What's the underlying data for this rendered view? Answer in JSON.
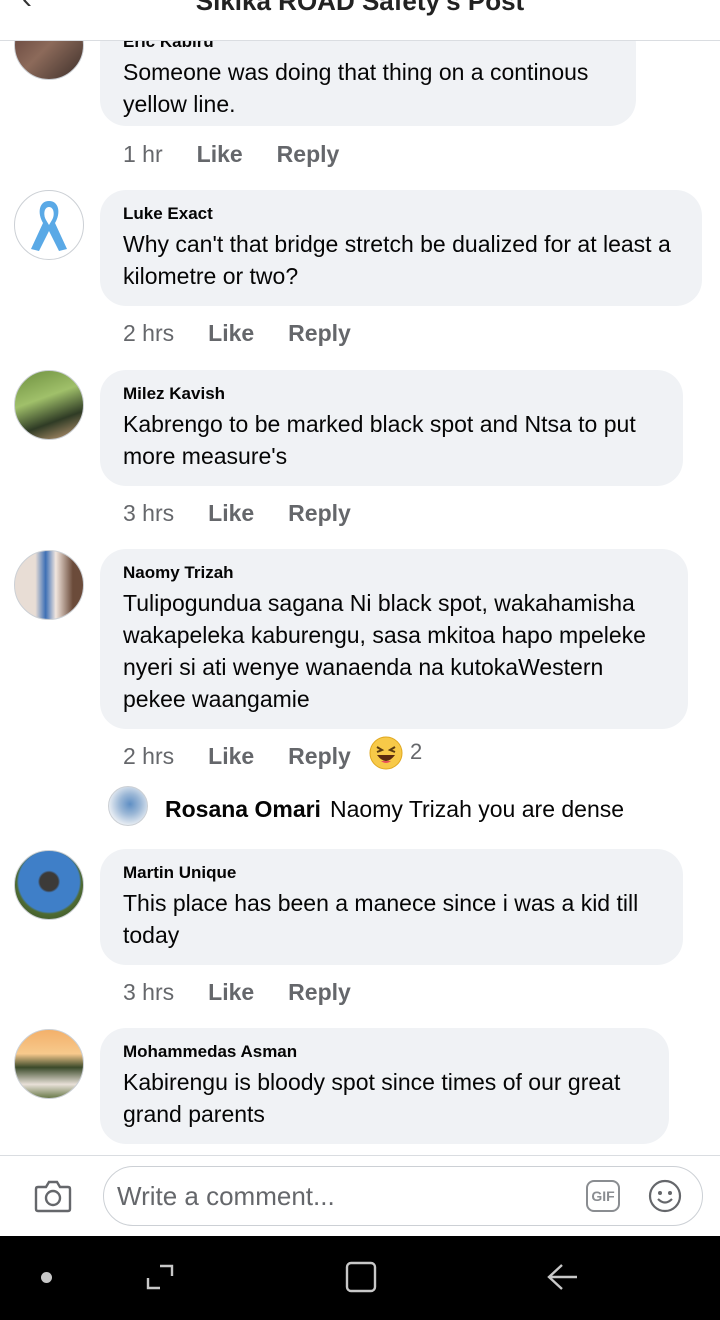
{
  "header": {
    "title": "Sikika ROAD Safety's Post"
  },
  "comments": [
    {
      "name": "Eric Kabiru",
      "text": "Someone was doing that thing on a continous yellow line.",
      "time": "1 hr",
      "like": "Like",
      "reply": "Reply"
    },
    {
      "name": "Luke Exact",
      "text": "Why can't that bridge stretch be dualized for at least a kilometre or two?",
      "time": "2 hrs",
      "like": "Like",
      "reply": "Reply"
    },
    {
      "name": "Milez Kavish",
      "text": "Kabrengo to be marked black spot and Ntsa to put more measure's",
      "time": "3 hrs",
      "like": "Like",
      "reply": "Reply"
    },
    {
      "name": "Naomy Trizah",
      "text": "Tulipogundua sagana Ni black spot, wakahamisha wakapeleka kaburengu, sasa mkitoa hapo mpeleke nyeri si ati wenye wanaenda na kutokaWestern pekee waangamie",
      "time": "2 hrs",
      "like": "Like",
      "reply": "Reply",
      "reaction_count": "2"
    },
    {
      "name": "Martin Unique",
      "text": "This place has been a manece since i was a kid till today",
      "time": "3 hrs",
      "like": "Like",
      "reply": "Reply"
    },
    {
      "name": "Mohammedas Asman",
      "text": "Kabirengu is bloody spot since times of our great grand parents"
    }
  ],
  "reply": {
    "name": "Rosana Omari",
    "text": "Naomy Trizah you are dense"
  },
  "composer": {
    "placeholder": "Write a comment...",
    "gif_label": "GIF"
  },
  "icons": {
    "camera": "camera-icon",
    "gif": "gif-icon",
    "emoji": "emoji-icon",
    "reaction": "haha-reaction-icon",
    "back": "back-arrow-icon"
  },
  "colors": {
    "bubble": "#f0f2f5",
    "meta": "#65676b",
    "navbar": "#000000"
  }
}
